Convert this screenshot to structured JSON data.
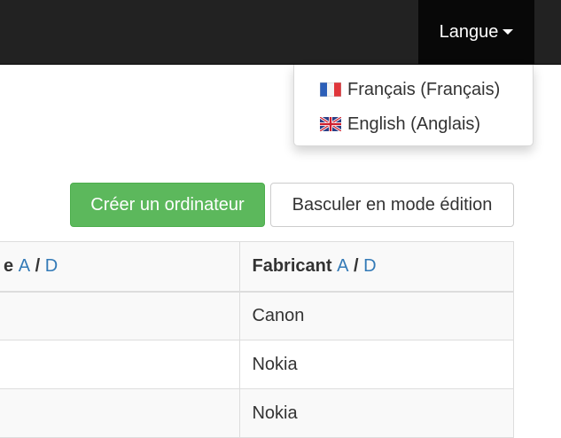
{
  "navbar": {
    "language_label": "Langue",
    "language_menu": [
      {
        "label": "Français (Français)",
        "flag": "fr"
      },
      {
        "label": "English (Anglais)",
        "flag": "gb"
      }
    ]
  },
  "toolbar": {
    "create_label": "Créer un ordinateur",
    "toggle_edit_label": "Basculer en mode édition"
  },
  "table": {
    "columns": [
      {
        "label": "e",
        "asc": "A",
        "sep": "/",
        "desc": "D"
      },
      {
        "label": "Fabricant",
        "asc": "A",
        "sep": "/",
        "desc": "D"
      }
    ],
    "rows": [
      [
        "",
        "Canon"
      ],
      [
        "",
        "Nokia"
      ],
      [
        "",
        "Nokia"
      ]
    ]
  },
  "colors": {
    "navbar_bg": "#222222",
    "success": "#5cb85c",
    "link": "#337ab7"
  }
}
